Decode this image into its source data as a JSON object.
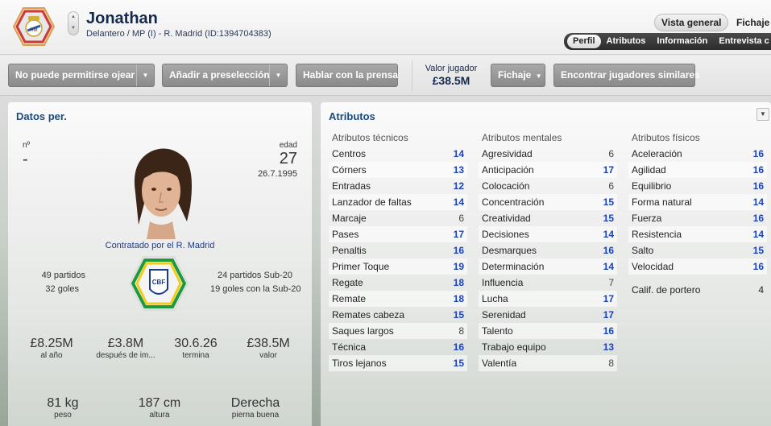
{
  "header": {
    "player_name": "Jonathan",
    "player_subtitle": "Delantero / MP (I) - R. Madrid (ID:1394704383)",
    "view_general": "Vista general",
    "view_fichaje": "Fichaje",
    "subtabs": [
      "Perfil",
      "Atributos",
      "Información",
      "Entrevista c"
    ]
  },
  "toolbar": {
    "scout_label": "No puede permitirse ojear",
    "shortlist_label": "Añadir a preselección",
    "press_label": "Hablar con la prensa",
    "value_label": "Valor jugador",
    "value_amount": "£38.5M",
    "transfer_label": "Fichaje",
    "similar_label": "Encontrar jugadores similares"
  },
  "left_panel": {
    "title": "Datos per.",
    "number_label": "nº",
    "number_value": "-",
    "age_label": "edad",
    "age_value": "27",
    "birth_date": "26.7.1995",
    "contract_text": "Contratado por el R. Madrid",
    "club_apps": "49 partidos",
    "club_goals": "32 goles",
    "u20_apps": "24 partidos Sub-20",
    "u20_goals": "19 goles con la Sub-20",
    "wage_value": "£8.25M",
    "wage_caption": "al año",
    "after_tax_value": "£3.8M",
    "after_tax_caption": "después de im...",
    "expires_value": "30.6.26",
    "expires_caption": "termina",
    "market_value": "£38.5M",
    "market_caption": "valor",
    "weight_value": "81 kg",
    "weight_caption": "peso",
    "height_value": "187 cm",
    "height_caption": "altura",
    "foot_value": "Derecha",
    "foot_caption": "pierna buena"
  },
  "attributes": {
    "title": "Atributos",
    "technical": {
      "heading": "Atributos técnicos",
      "items": [
        {
          "name": "Centros",
          "value": "14"
        },
        {
          "name": "Córners",
          "value": "13"
        },
        {
          "name": "Entradas",
          "value": "12"
        },
        {
          "name": "Lanzador de faltas",
          "value": "14"
        },
        {
          "name": "Marcaje",
          "value": "6"
        },
        {
          "name": "Pases",
          "value": "17"
        },
        {
          "name": "Penaltis",
          "value": "16"
        },
        {
          "name": "Primer Toque",
          "value": "19"
        },
        {
          "name": "Regate",
          "value": "18"
        },
        {
          "name": "Remate",
          "value": "18"
        },
        {
          "name": "Remates cabeza",
          "value": "15"
        },
        {
          "name": "Saques largos",
          "value": "8"
        },
        {
          "name": "Técnica",
          "value": "16"
        },
        {
          "name": "Tiros lejanos",
          "value": "15"
        }
      ]
    },
    "mental": {
      "heading": "Atributos mentales",
      "items": [
        {
          "name": "Agresividad",
          "value": "6"
        },
        {
          "name": "Anticipación",
          "value": "17"
        },
        {
          "name": "Colocación",
          "value": "6"
        },
        {
          "name": "Concentración",
          "value": "15"
        },
        {
          "name": "Creatividad",
          "value": "15"
        },
        {
          "name": "Decisiones",
          "value": "14"
        },
        {
          "name": "Desmarques",
          "value": "16"
        },
        {
          "name": "Determinación",
          "value": "14"
        },
        {
          "name": "Influencia",
          "value": "7"
        },
        {
          "name": "Lucha",
          "value": "17"
        },
        {
          "name": "Serenidad",
          "value": "17"
        },
        {
          "name": "Talento",
          "value": "16"
        },
        {
          "name": "Trabajo equipo",
          "value": "13"
        },
        {
          "name": "Valentía",
          "value": "8"
        }
      ]
    },
    "physical": {
      "heading": "Atributos físicos",
      "items": [
        {
          "name": "Aceleración",
          "value": "16"
        },
        {
          "name": "Agilidad",
          "value": "16"
        },
        {
          "name": "Equilibrio",
          "value": "16"
        },
        {
          "name": "Forma natural",
          "value": "14"
        },
        {
          "name": "Fuerza",
          "value": "16"
        },
        {
          "name": "Resistencia",
          "value": "14"
        },
        {
          "name": "Salto",
          "value": "15"
        },
        {
          "name": "Velocidad",
          "value": "16"
        }
      ],
      "gk_label": "Calif. de portero",
      "gk_value": "4"
    }
  },
  "colors": {
    "highlight_value": "#1c42b8",
    "title_blue": "#1b4a7a"
  }
}
